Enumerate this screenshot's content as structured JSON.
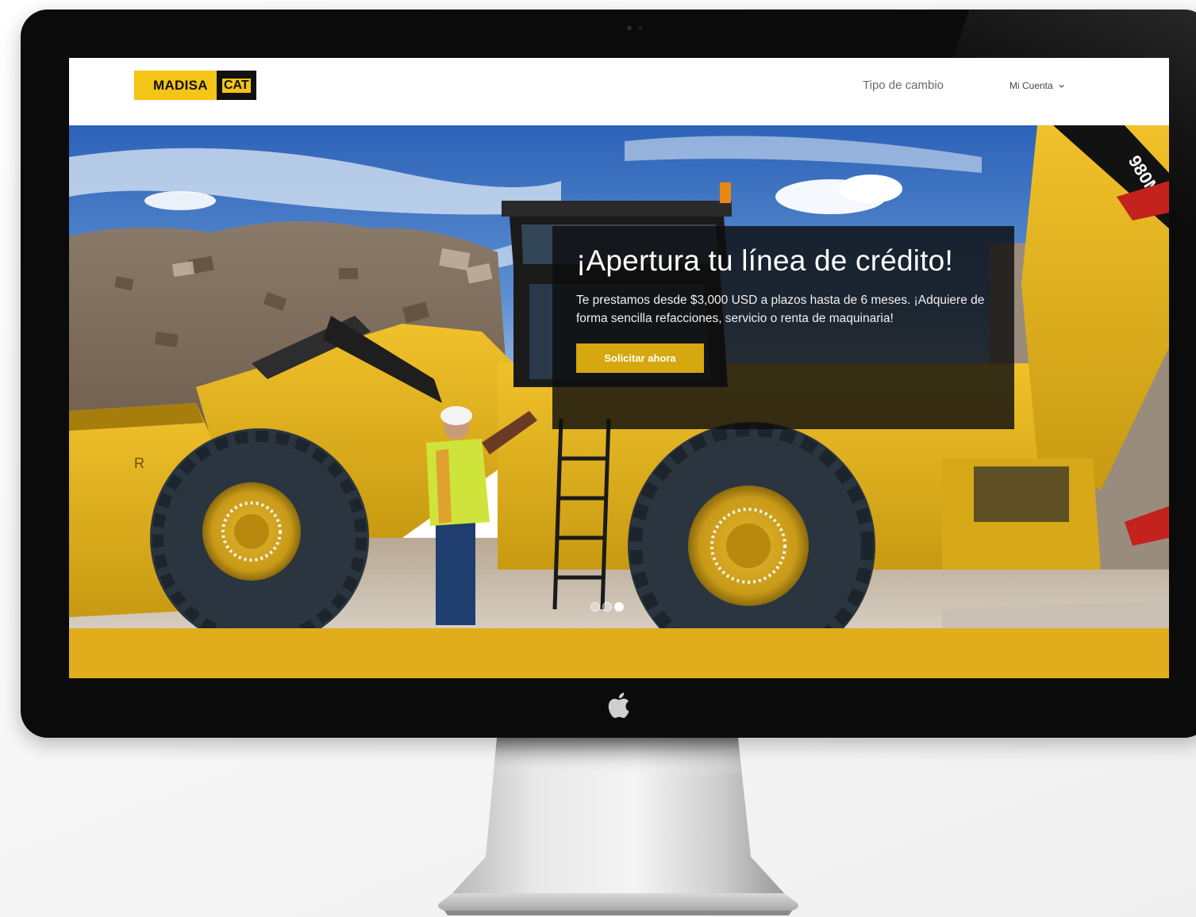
{
  "header": {
    "logo_brand": "MADISA",
    "logo_partner": "CAT",
    "nav": {
      "exchange_rate": "Tipo de cambio",
      "account": "Mi Cuenta"
    }
  },
  "hero": {
    "title": "¡Apertura tu línea de crédito!",
    "description": "Te prestamos desde $3,000 USD a plazos hasta de 6 meses. ¡Adquiere de forma sencilla refacciones, servicio o renta de maquinaria!",
    "cta_label": "Solicitar ahora",
    "machine_model": "980M",
    "slides_total": 3,
    "active_slide": 3
  },
  "colors": {
    "brand_yellow": "#f4c417",
    "cta_yellow": "#d4a80e",
    "band_yellow": "#e1ad1c",
    "overlay": "#0e0e0e"
  },
  "icons": {
    "account_chevron": "chevron-down-icon",
    "monitor_logo": "apple-logo-icon"
  }
}
